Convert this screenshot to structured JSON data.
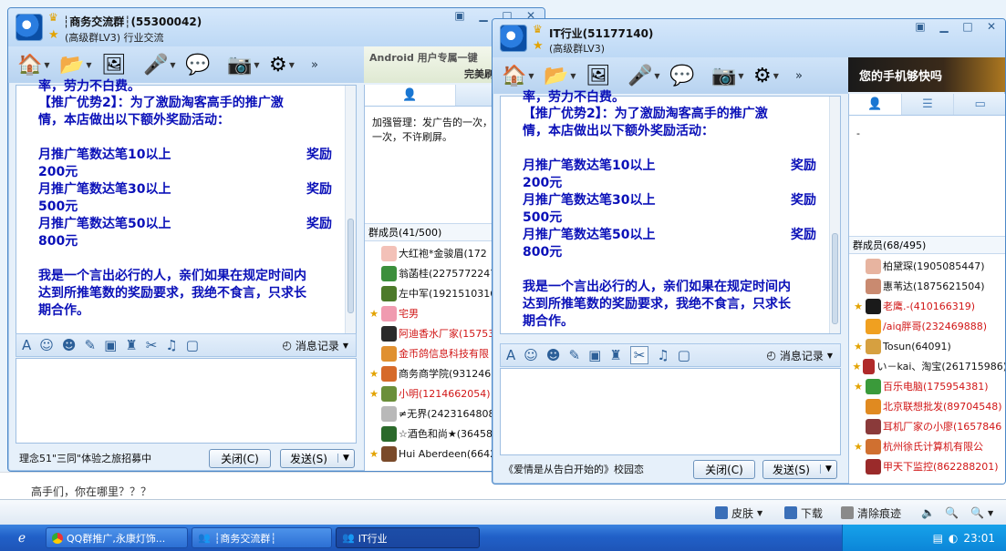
{
  "background_page": {
    "question": "高手们，你在哪里？？？",
    "toolbar": {
      "skin": "皮肤",
      "download": "下载",
      "clear_history": "清除痕迹"
    }
  },
  "window1": {
    "title": "┆商务交流群┆(55300042)",
    "subtitle": "(高级群LV3) 行业交流",
    "more": "»",
    "message_lines": [
      {
        "text": "【推广优势2】：为了激励淘客高手的推广激"
      },
      {
        "text": "情，本店做出以下额外奖励活动："
      },
      {
        "text": ""
      },
      {
        "text": "月推广笔数达笔10以上",
        "right": "奖励"
      },
      {
        "text": "200元"
      },
      {
        "text": "月推广笔数达笔30以上",
        "right": "奖励"
      },
      {
        "text": "500元"
      },
      {
        "text": "月推广笔数达笔50以上",
        "right": "奖励"
      },
      {
        "text": "800元"
      },
      {
        "text": ""
      },
      {
        "text": "我是一个言出必行的人，亲们如果在规定时间内"
      },
      {
        "text": "达到所推笔数的奖励要求，我绝不食言，只求长"
      },
      {
        "text": "期合作。"
      }
    ],
    "top_partial": "率，劳力不白费。",
    "history_label": "消息记录",
    "ad_text": "理念51\"三同\"体验之旅招募中",
    "close_label": "关闭(C)",
    "send_label": "发送(S)",
    "banner_text_1": "Android 用户专属一键",
    "banner_text_2": "完美刷",
    "notice": "加强管理：发广告的一次，不许刷屏。",
    "notice_line2": "一次，不许刷屏。",
    "member_header": "群成员(41/500)",
    "members": [
      {
        "rank": "",
        "name": "大红袍*金骏眉(172",
        "red": false,
        "color": "#f3c1b8"
      },
      {
        "rank": "",
        "name": "翁菡桂(2275772247)",
        "red": false,
        "color": "#3c8f3c"
      },
      {
        "rank": "",
        "name": "左中军(1921510316)",
        "red": false,
        "color": "#4d7a2a"
      },
      {
        "rank": "★",
        "name": "宅男",
        "red": true,
        "color": "#f09bb0"
      },
      {
        "rank": "",
        "name": "阿迪香水厂家(15753",
        "red": true,
        "color": "#2a2a2a"
      },
      {
        "rank": "",
        "name": "金币鸽信息科技有限",
        "red": true,
        "color": "#e09030"
      },
      {
        "rank": "★",
        "name": "商务商学院(9312467",
        "red": false,
        "color": "#d66a2a"
      },
      {
        "rank": "★",
        "name": "小明(1214662054)",
        "red": true,
        "color": "#6b8f3a"
      },
      {
        "rank": "",
        "name": "≠无界(2423164808)",
        "red": false,
        "color": "#b9b9b9"
      },
      {
        "rank": "",
        "name": "☆酒色和尚★(36458",
        "red": false,
        "color": "#2b6a2b"
      },
      {
        "rank": "★",
        "name": "Hui Aberdeen(664245",
        "red": false,
        "color": "#7a4a2a"
      }
    ]
  },
  "window2": {
    "title": "IT行业(51177140)",
    "subtitle": "(高级群LV3)",
    "more": "»",
    "top_partial": "率，劳力不白费。",
    "message_lines": [
      {
        "text": "【推广优势2】：为了激励淘客高手的推广激"
      },
      {
        "text": "情，本店做出以下额外奖励活动："
      },
      {
        "text": ""
      },
      {
        "text": "月推广笔数达笔10以上",
        "right": "奖励"
      },
      {
        "text": "200元"
      },
      {
        "text": "月推广笔数达笔30以上",
        "right": "奖励"
      },
      {
        "text": "500元"
      },
      {
        "text": "月推广笔数达笔50以上",
        "right": "奖励"
      },
      {
        "text": "800元"
      },
      {
        "text": ""
      },
      {
        "text": "我是一个言出必行的人，亲们如果在规定时间内"
      },
      {
        "text": "达到所推笔数的奖励要求，我绝不食言，只求长"
      },
      {
        "text": "期合作。"
      }
    ],
    "history_label": "消息记录",
    "ad_text": "《爱情是从告白开始的》校园恋",
    "close_label": "关闭(C)",
    "send_label": "发送(S)",
    "banner_text": "您的手机够快吗",
    "notice": "-",
    "member_header": "群成员(68/495)",
    "members": [
      {
        "rank": "",
        "name": "柏黛琛(1905085447)",
        "red": false,
        "color": "#e7b4a0"
      },
      {
        "rank": "",
        "name": "惠苇达(1875621504)",
        "red": false,
        "color": "#c98a70"
      },
      {
        "rank": "★",
        "name": "老鹰.-(410166319)",
        "red": true,
        "color": "#1a1a1a"
      },
      {
        "rank": "",
        "name": "/aiq胖哥(232469888)",
        "red": true,
        "color": "#f0a020"
      },
      {
        "rank": "★",
        "name": "Tosun(64091)",
        "red": false,
        "color": "#d6a040"
      },
      {
        "rank": "★",
        "name": "い－kai、淘宝(261715986)",
        "red": false,
        "color": "#b02a2a"
      },
      {
        "rank": "★",
        "name": "百乐电脑(175954381)",
        "red": true,
        "color": "#3a9a3a"
      },
      {
        "rank": "",
        "name": "北京联想批发(89704548)",
        "red": true,
        "color": "#e08a20"
      },
      {
        "rank": "",
        "name": "耳机厂家の小廖(1657846",
        "red": true,
        "color": "#8a3a3a"
      },
      {
        "rank": "★",
        "name": "杭州徐氏计算机有限公",
        "red": true,
        "color": "#d07030"
      },
      {
        "rank": "",
        "name": "甲天下监控(862288201)",
        "red": true,
        "color": "#9a2a2a"
      }
    ]
  },
  "taskbar": {
    "items": [
      {
        "label": "QQ群推广,永康灯饰..."
      },
      {
        "label": "┆商务交流群┆"
      },
      {
        "label": "IT行业"
      }
    ],
    "clock": "23:01"
  }
}
